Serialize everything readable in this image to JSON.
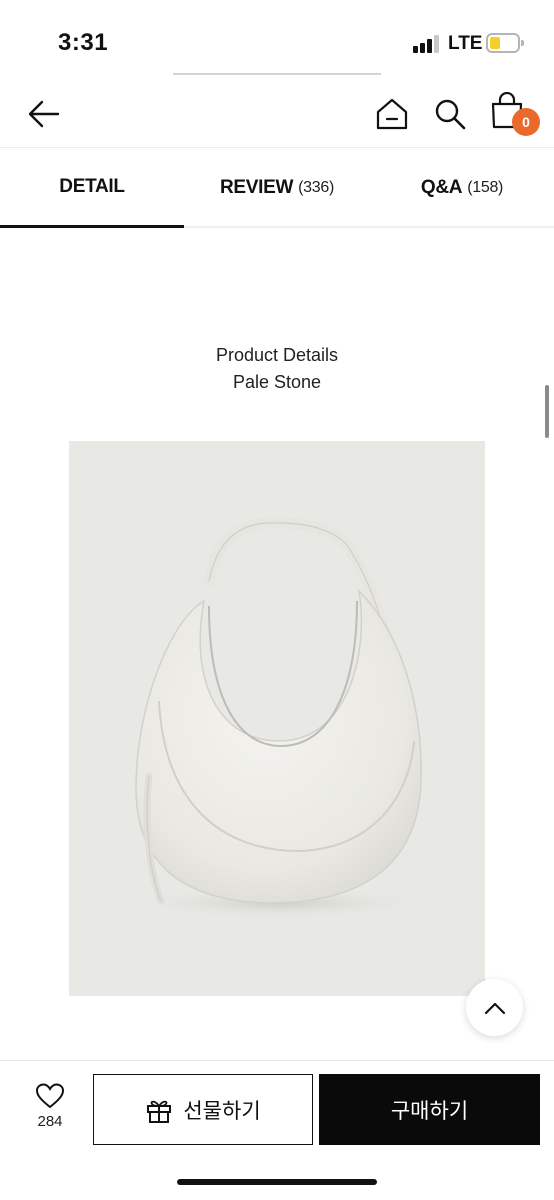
{
  "status_bar": {
    "time": "3:31",
    "network": "LTE",
    "battery_color": "#f5cf2a"
  },
  "header": {
    "back_icon": "arrow-left-icon",
    "home_icon": "home-icon",
    "search_icon": "search-icon",
    "cart_icon": "shopping-bag-icon",
    "cart_count": "0",
    "badge_color": "#ea6a2c"
  },
  "tabs": [
    {
      "label": "DETAIL",
      "count": "",
      "active": true
    },
    {
      "label": "REVIEW",
      "count": "(336)",
      "active": false
    },
    {
      "label": "Q&A",
      "count": "(158)",
      "active": false
    }
  ],
  "content": {
    "title_line1": "Product Details",
    "title_line2": "Pale Stone",
    "image_subject": "pale stone crescent hobo shoulder bag"
  },
  "scroll_top_icon": "chevron-up-icon",
  "bottom_bar": {
    "like_icon": "heart-icon",
    "like_count": "284",
    "gift_icon": "gift-icon",
    "gift_label": "선물하기",
    "buy_label": "구매하기",
    "buy_color": "#0a0a0a"
  }
}
